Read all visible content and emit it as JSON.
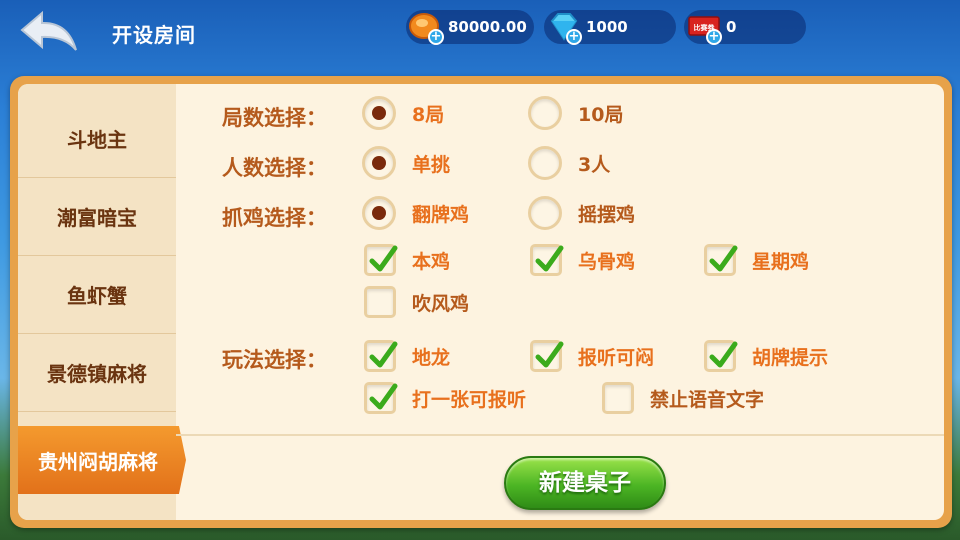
{
  "header": {
    "title": "开设房间",
    "resources": [
      {
        "name": "coin",
        "value": "80000.00"
      },
      {
        "name": "diamond",
        "value": "1000"
      },
      {
        "name": "ticket",
        "value": "0",
        "icon_text": "比赛券"
      }
    ]
  },
  "sidebar": {
    "items": [
      "斗地主",
      "潮富暗宝",
      "鱼虾蟹",
      "景德镇麻将"
    ],
    "active": "贵州闷胡麻将"
  },
  "form": {
    "rounds": {
      "label": "局数选择：",
      "options": [
        {
          "text": "8局",
          "selected": true
        },
        {
          "text": "10局",
          "selected": false
        }
      ]
    },
    "players": {
      "label": "人数选择：",
      "options": [
        {
          "text": "单挑",
          "selected": true
        },
        {
          "text": "3人",
          "selected": false
        }
      ]
    },
    "chicken": {
      "label": "抓鸡选择：",
      "options": [
        {
          "text": "翻牌鸡",
          "selected": true
        },
        {
          "text": "摇摆鸡",
          "selected": false
        }
      ],
      "checks": [
        {
          "text": "本鸡",
          "checked": true
        },
        {
          "text": "乌骨鸡",
          "checked": true
        },
        {
          "text": "星期鸡",
          "checked": true
        },
        {
          "text": "吹风鸡",
          "checked": false
        }
      ]
    },
    "play": {
      "label": "玩法选择：",
      "checks": [
        {
          "text": "地龙",
          "checked": true
        },
        {
          "text": "报听可闷",
          "checked": true
        },
        {
          "text": "胡牌提示",
          "checked": true
        },
        {
          "text": "打一张可报听",
          "checked": true
        },
        {
          "text": "禁止语音文字",
          "checked": false
        }
      ]
    }
  },
  "create_button": "新建桌子",
  "colors": {
    "accent": "#e8701d",
    "label": "#b55a1c",
    "panel": "#fdf3e0",
    "button": "#4cb524"
  }
}
